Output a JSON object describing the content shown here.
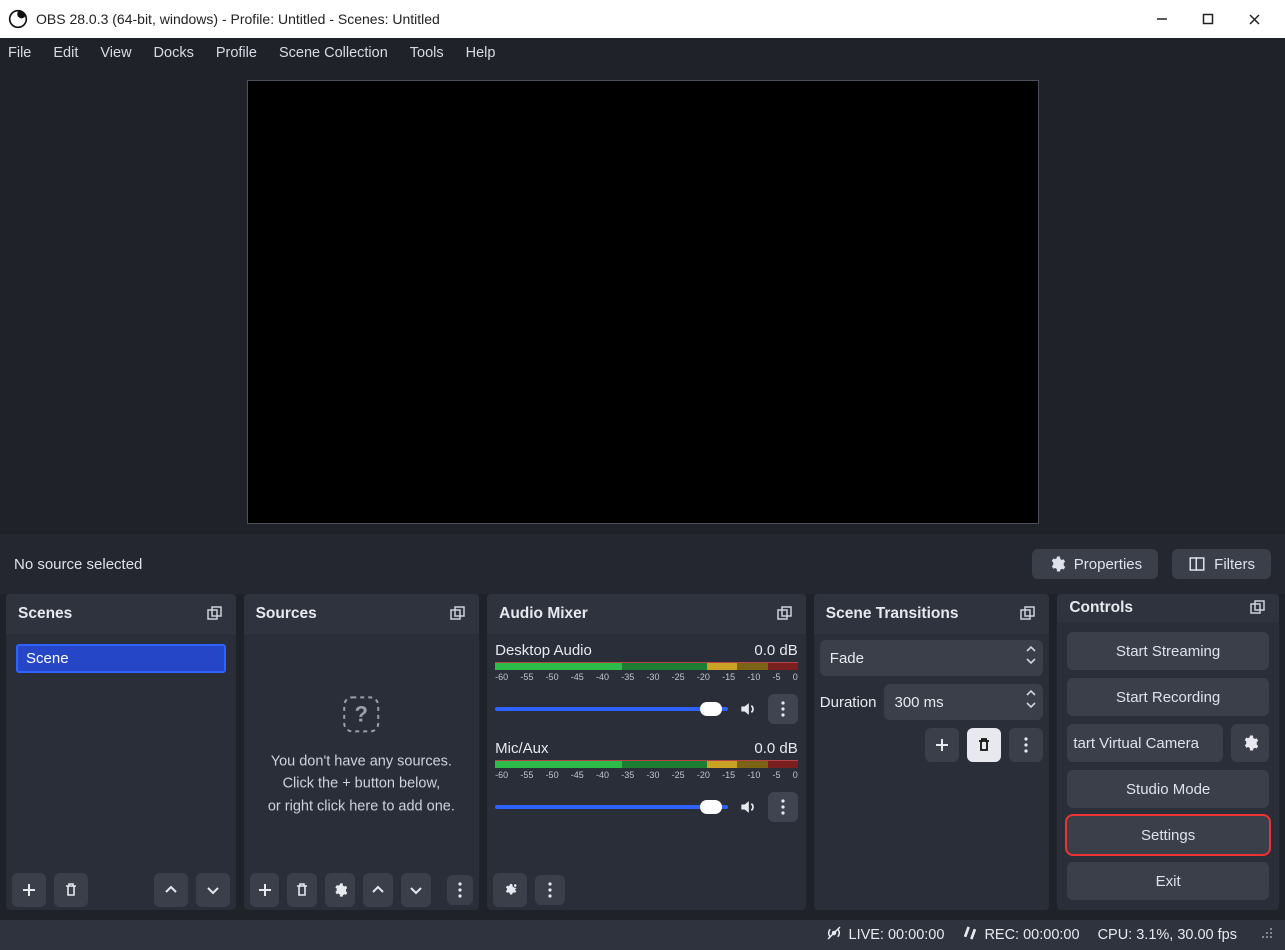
{
  "window": {
    "title": "OBS 28.0.3 (64-bit, windows) - Profile: Untitled - Scenes: Untitled"
  },
  "menu": {
    "items": [
      "File",
      "Edit",
      "View",
      "Docks",
      "Profile",
      "Scene Collection",
      "Tools",
      "Help"
    ]
  },
  "source_toolbar": {
    "no_source": "No source selected",
    "properties": "Properties",
    "filters": "Filters"
  },
  "docks": {
    "scenes": {
      "title": "Scenes",
      "items": [
        "Scene"
      ]
    },
    "sources": {
      "title": "Sources",
      "empty_line1": "You don't have any sources.",
      "empty_line2": "Click the + button below,",
      "empty_line3": "or right click here to add one."
    },
    "audio": {
      "title": "Audio Mixer",
      "items": [
        {
          "name": "Desktop Audio",
          "db": "0.0 dB"
        },
        {
          "name": "Mic/Aux",
          "db": "0.0 dB"
        }
      ],
      "ticks": [
        "-60",
        "-55",
        "-50",
        "-45",
        "-40",
        "-35",
        "-30",
        "-25",
        "-20",
        "-15",
        "-10",
        "-5",
        "0"
      ]
    },
    "transitions": {
      "title": "Scene Transitions",
      "selected": "Fade",
      "duration_label": "Duration",
      "duration_value": "300 ms"
    },
    "controls": {
      "title": "Controls",
      "start_streaming": "Start Streaming",
      "start_recording": "Start Recording",
      "virtual_camera": "tart Virtual Camera",
      "studio_mode": "Studio Mode",
      "settings": "Settings",
      "exit": "Exit"
    }
  },
  "status": {
    "live": "LIVE: 00:00:00",
    "rec": "REC: 00:00:00",
    "cpu": "CPU: 3.1%, 30.00 fps"
  }
}
